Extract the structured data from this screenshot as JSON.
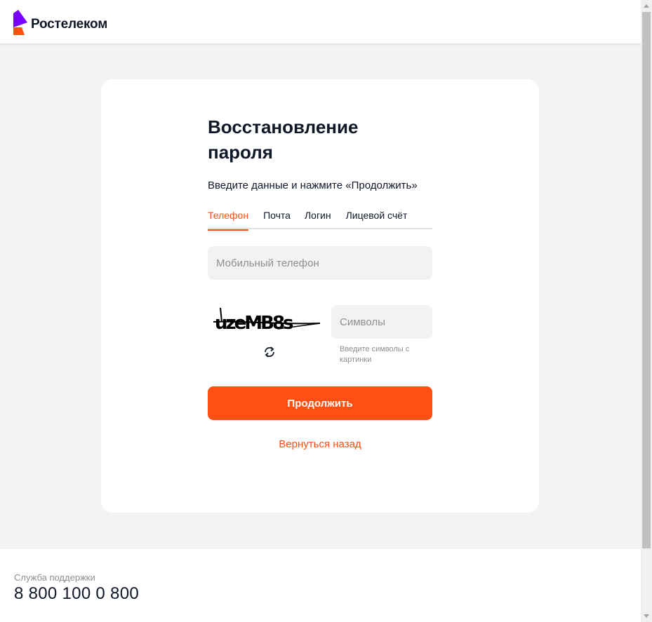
{
  "header": {
    "brand": "Ростелеком",
    "brand_colors": {
      "top": "#7700ff",
      "bottom": "#ff4f12"
    }
  },
  "form": {
    "title": "Восстановление пароля",
    "subtitle": "Введите данные и нажмите «Продолжить»",
    "tabs": [
      {
        "label": "Телефон",
        "active": true
      },
      {
        "label": "Почта",
        "active": false
      },
      {
        "label": "Логин",
        "active": false
      },
      {
        "label": "Лицевой счёт",
        "active": false
      }
    ],
    "phone_placeholder": "Мобильный телефон",
    "captcha": {
      "image_text": "uzeMB8s",
      "refresh_icon": "refresh-icon",
      "input_placeholder": "Символы",
      "hint": "Введите символы с картинки"
    },
    "continue_label": "Продолжить",
    "back_label": "Вернуться назад"
  },
  "footer": {
    "support_label": "Служба поддержки",
    "support_phone": "8 800 100 0 800"
  },
  "colors": {
    "accent": "#ff4f12",
    "page_background": "#f3f3f3",
    "input_background": "#f2f2f2",
    "text": "#101828",
    "muted": "#8e8e93"
  }
}
